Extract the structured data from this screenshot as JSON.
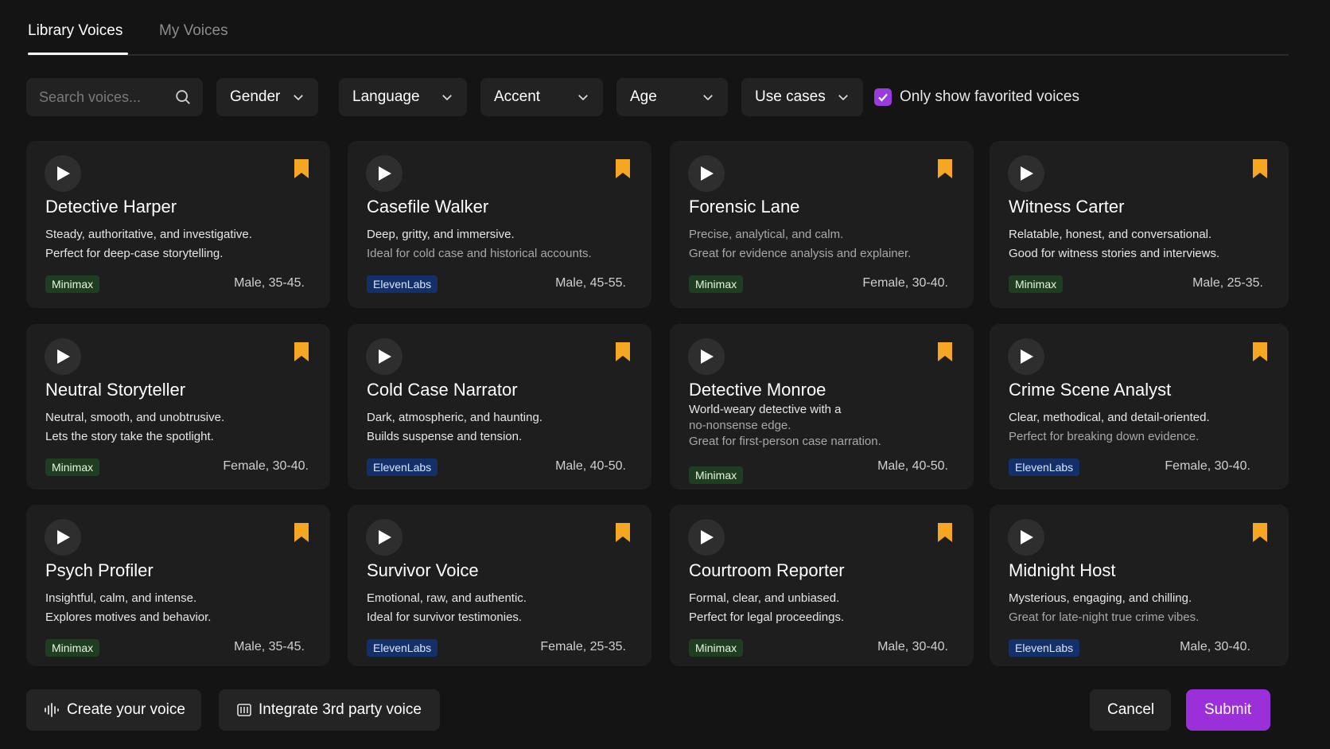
{
  "tabs": [
    {
      "label": "Library Voices",
      "active": true
    },
    {
      "label": "My Voices",
      "active": false
    }
  ],
  "filters": {
    "search_placeholder": "Search voices...",
    "dropdowns": [
      "Gender",
      "Language",
      "Accent",
      "Age",
      "Use cases"
    ],
    "favorites_label": "Only show favorited voices",
    "favorites_checked": true
  },
  "colors": {
    "accent": "#9b2fd9",
    "bookmark": "#f5a623",
    "minimax_badge": "#1f3d21",
    "elevenlabs_badge": "#14306a"
  },
  "voices": [
    {
      "name": "Detective Harper",
      "line1": "Steady, authoritative, and investigative.",
      "line2": "Perfect for deep-case storytelling.",
      "provider": "Minimax",
      "meta": "Male, 35-45."
    },
    {
      "name": "Casefile Walker",
      "line1": "Deep, gritty, and immersive.",
      "line2": "Ideal for cold case and historical accounts.",
      "provider": "ElevenLabs",
      "meta": "Male, 45-55."
    },
    {
      "name": "Forensic Lane",
      "line1": "Precise, analytical, and calm.",
      "line2": "Great for evidence analysis and explainer.",
      "provider": "Minimax",
      "meta": "Female, 30-40."
    },
    {
      "name": "Witness Carter",
      "line1": "Relatable, honest, and conversational.",
      "line2": "Good for witness stories and interviews.",
      "provider": "Minimax",
      "meta": "Male, 25-35."
    },
    {
      "name": "Neutral Storyteller",
      "line1": "Neutral, smooth, and unobtrusive.",
      "line2": "Lets the story take the spotlight.",
      "provider": "Minimax",
      "meta": "Female, 30-40."
    },
    {
      "name": "Cold Case Narrator",
      "line1": "Dark, atmospheric, and haunting.",
      "line2": "Builds suspense and tension.",
      "provider": "ElevenLabs",
      "meta": "Male, 40-50."
    },
    {
      "name": "Detective Monroe",
      "line1": "World-weary detective with a",
      "line1b": "no-nonsense edge.",
      "line2": "Great for first-person case narration.",
      "provider": "Minimax",
      "meta": "Male, 40-50."
    },
    {
      "name": "Crime Scene Analyst",
      "line1": "Clear, methodical, and detail-oriented.",
      "line2": "Perfect for breaking down evidence.",
      "provider": "ElevenLabs",
      "meta": "Female, 30-40."
    },
    {
      "name": "Psych Profiler",
      "line1": "Insightful, calm, and intense.",
      "line2": "Explores motives and behavior.",
      "provider": "Minimax",
      "meta": "Male, 35-45."
    },
    {
      "name": "Survivor Voice",
      "line1": "Emotional, raw, and authentic.",
      "line2": "Ideal for survivor testimonies.",
      "provider": "ElevenLabs",
      "meta": "Female, 25-35."
    },
    {
      "name": "Courtroom Reporter",
      "line1": "Formal, clear, and unbiased.",
      "line2": "Perfect for legal proceedings.",
      "provider": "Minimax",
      "meta": "Male, 30-40."
    },
    {
      "name": "Midnight Host",
      "line1": "Mysterious, engaging, and chilling.",
      "line2": "Great for late-night true crime vibes.",
      "provider": "ElevenLabs",
      "meta": "Male, 30-40."
    }
  ],
  "footer": {
    "create_label": "Create your voice",
    "integrate_label": "Integrate 3rd party voice",
    "cancel_label": "Cancel",
    "submit_label": "Submit"
  }
}
